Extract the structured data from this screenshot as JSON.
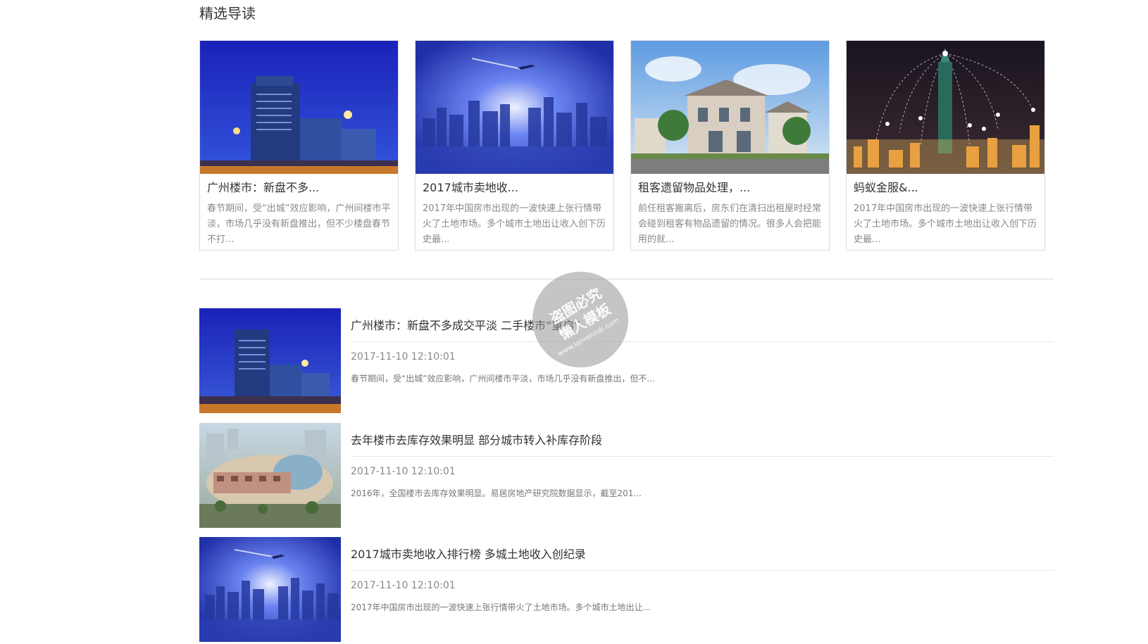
{
  "section": {
    "title": "精选导读"
  },
  "featured": [
    {
      "title": "广州楼市：新盘不多...",
      "desc": "春节期间，受“出城”效应影响，广州间楼市平淡，市场几乎没有新盘推出，但不少楼盘春节不打...",
      "image": "night-building"
    },
    {
      "title": "2017城市卖地收...",
      "desc": "2017年中国房市出现的一波快速上张行情带火了土地市场。多个城市土地出让收入创下历史最...",
      "image": "blue-city"
    },
    {
      "title": "租客遗留物品处理，...",
      "desc": "前任租客搬离后，房东们在清扫出租屋时经常会碰到租客有物品遗留的情况。很多人会把能用的就...",
      "image": "villa"
    },
    {
      "title": "蚂蚁金服&...",
      "desc": "2017年中国房市出现的一波快速上张行情带火了土地市场。多个城市土地出让收入创下历史最...",
      "image": "tower-night"
    }
  ],
  "news": [
    {
      "title": "广州楼市：新盘不多成交平淡 二手楼市“重启”",
      "date": "2017-11-10 12:10:01",
      "desc": "春节期间，受“出城”效应影响，广州间楼市平淡，市场几乎没有新盘推出，但不...",
      "image": "night-building"
    },
    {
      "title": "去年楼市去库存效果明显 部分城市转入补库存阶段",
      "date": "2017-11-10 12:10:01",
      "desc": "2016年，全国楼市去库存效果明显。易居房地产研究院数据显示，截至201...",
      "image": "mall-render"
    },
    {
      "title": "2017城市卖地收入排行榜 多城土地收入创纪录",
      "date": "2017-11-10 12:10:01",
      "desc": "2017年中国房市出现的一波快速上张行情带火了土地市场。多个城市土地出让...",
      "image": "blue-city"
    }
  ],
  "watermark": {
    "line1": "盗图必究",
    "line2": "懒人模板",
    "url": "www.lanrenmb.com"
  }
}
